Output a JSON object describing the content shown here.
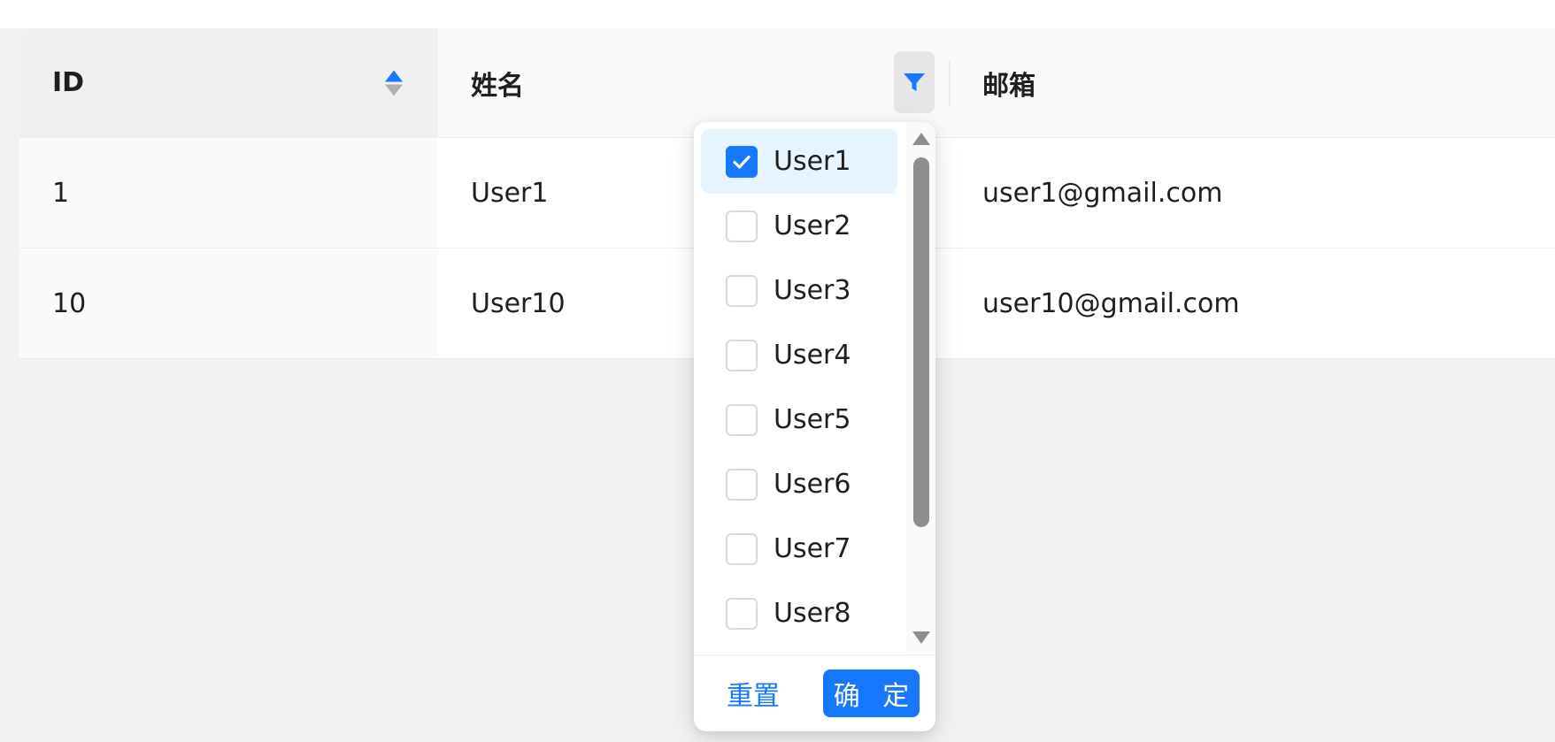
{
  "colors": {
    "accent": "#1677ff",
    "selected_bg": "#e6f4ff",
    "header_bg": "#fafafa",
    "page_bg": "#f2f2f2"
  },
  "table": {
    "columns": [
      {
        "label": "ID",
        "sortable": true,
        "sort_order": "ascend"
      },
      {
        "label": "姓名",
        "filterable": true,
        "filter_active": true
      },
      {
        "label": "邮箱"
      }
    ],
    "rows": [
      {
        "id": "1",
        "name": "User1",
        "email": "user1@gmail.com"
      },
      {
        "id": "10",
        "name": "User10",
        "email": "user10@gmail.com"
      }
    ]
  },
  "filter_dropdown": {
    "items": [
      {
        "label": "User1",
        "checked": true
      },
      {
        "label": "User2",
        "checked": false
      },
      {
        "label": "User3",
        "checked": false
      },
      {
        "label": "User4",
        "checked": false
      },
      {
        "label": "User5",
        "checked": false
      },
      {
        "label": "User6",
        "checked": false
      },
      {
        "label": "User7",
        "checked": false
      },
      {
        "label": "User8",
        "checked": false
      }
    ],
    "reset_label": "重置",
    "confirm_label": "确 定"
  },
  "icons": {
    "sorter": "sort-caret-icon",
    "filter": "filter-funnel-icon",
    "check": "check-icon"
  }
}
